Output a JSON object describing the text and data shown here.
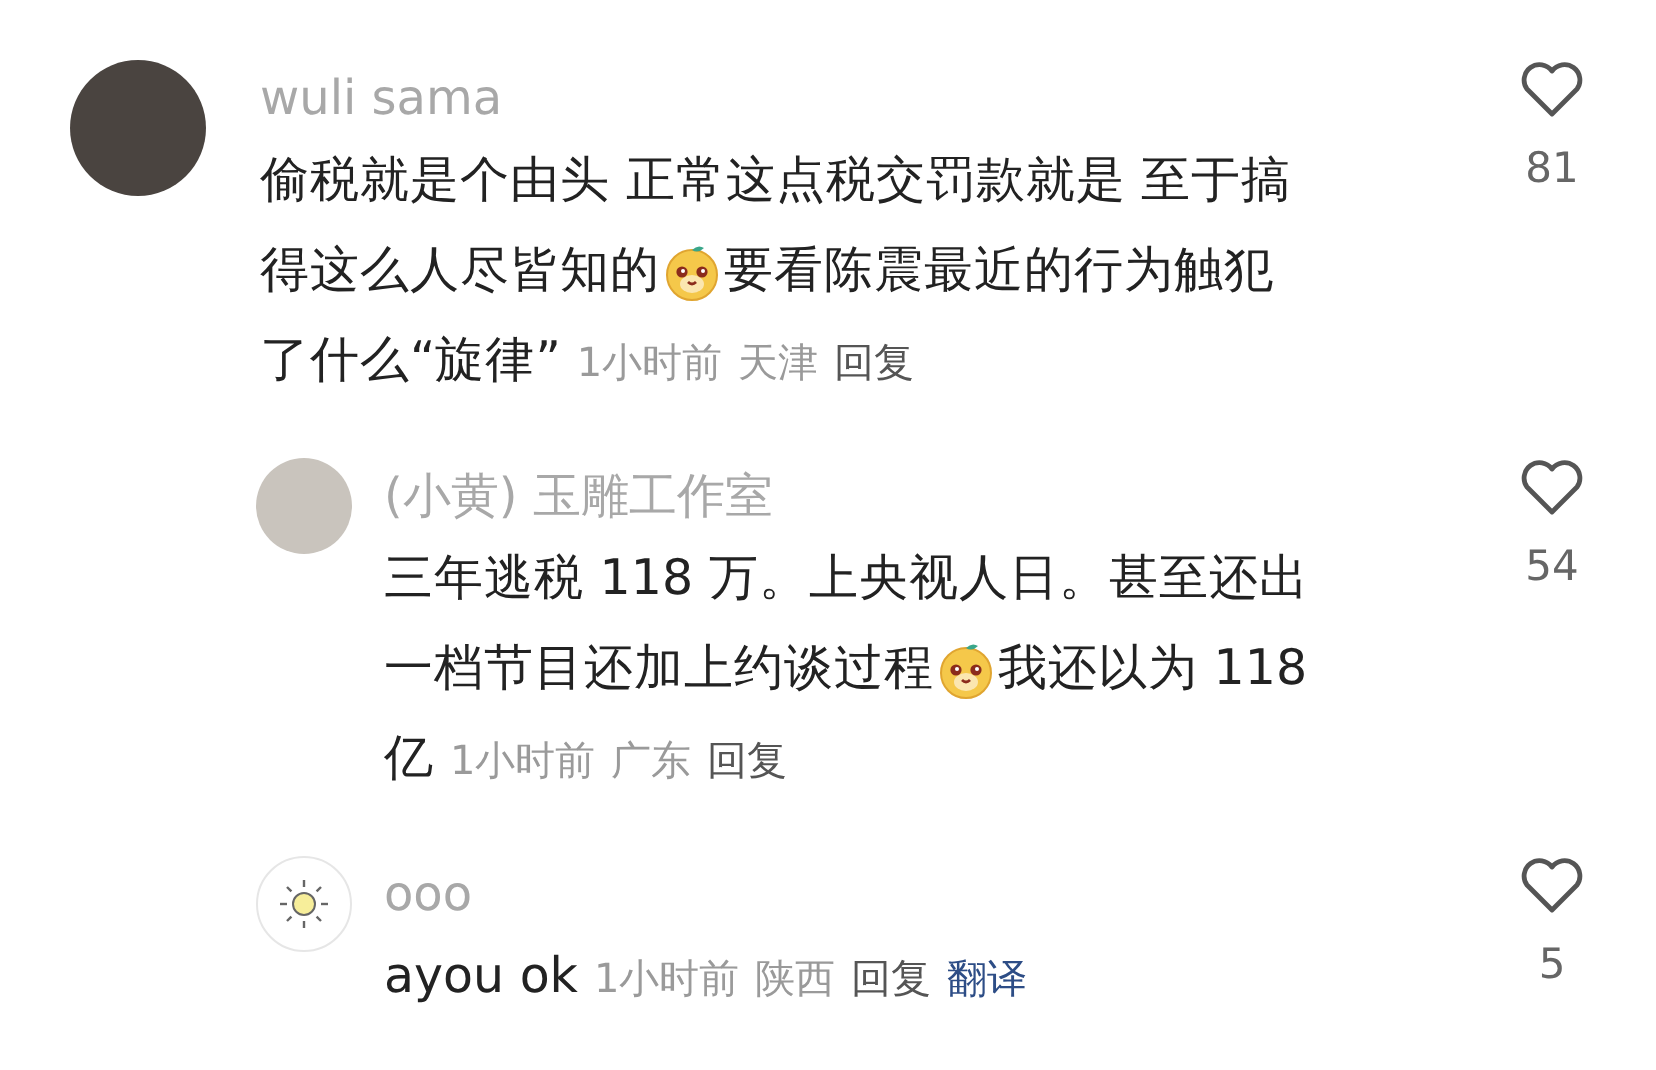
{
  "comments": [
    {
      "avatar": {
        "kind": "photo"
      },
      "name": "wuli sama",
      "lines": [
        [
          {
            "kind": "text",
            "text": "偷税就是个由头 正常这点税交罚款就是 至于搞"
          }
        ],
        [
          {
            "kind": "text",
            "text": "得这么人尽皆知的"
          },
          {
            "kind": "emoji"
          },
          {
            "kind": "text",
            "text": "要看陈震最近的行为触犯"
          }
        ],
        [
          {
            "kind": "text",
            "text": "了什么“旋律”"
          }
        ]
      ],
      "meta": [
        {
          "kind": "time",
          "text": "1小时前"
        },
        {
          "kind": "location",
          "text": "天津"
        },
        {
          "kind": "reply",
          "text": "回复"
        }
      ],
      "likes": "81",
      "replies": [
        {
          "avatar": {
            "kind": "photo"
          },
          "name": "(小黄) 玉雕工作室",
          "lines": [
            [
              {
                "kind": "text",
                "text": "三年逃税 118 万。上央视人日。甚至还出"
              }
            ],
            [
              {
                "kind": "text",
                "text": "一档节目还加上约谈过程"
              },
              {
                "kind": "emoji"
              },
              {
                "kind": "text",
                "text": "我还以为 118"
              }
            ],
            [
              {
                "kind": "text",
                "text": "亿"
              }
            ]
          ],
          "meta": [
            {
              "kind": "time",
              "text": "1小时前"
            },
            {
              "kind": "location",
              "text": "广东"
            },
            {
              "kind": "reply",
              "text": "回复"
            }
          ],
          "likes": "54"
        },
        {
          "avatar": {
            "kind": "sun"
          },
          "name": "ooo",
          "lines": [
            [
              {
                "kind": "text",
                "text": "ayou ok"
              }
            ]
          ],
          "meta": [
            {
              "kind": "time",
              "text": "1小时前"
            },
            {
              "kind": "location",
              "text": "陕西"
            },
            {
              "kind": "reply",
              "text": "回复"
            },
            {
              "kind": "translate",
              "text": "翻译"
            }
          ],
          "likes": "5"
        }
      ]
    }
  ]
}
